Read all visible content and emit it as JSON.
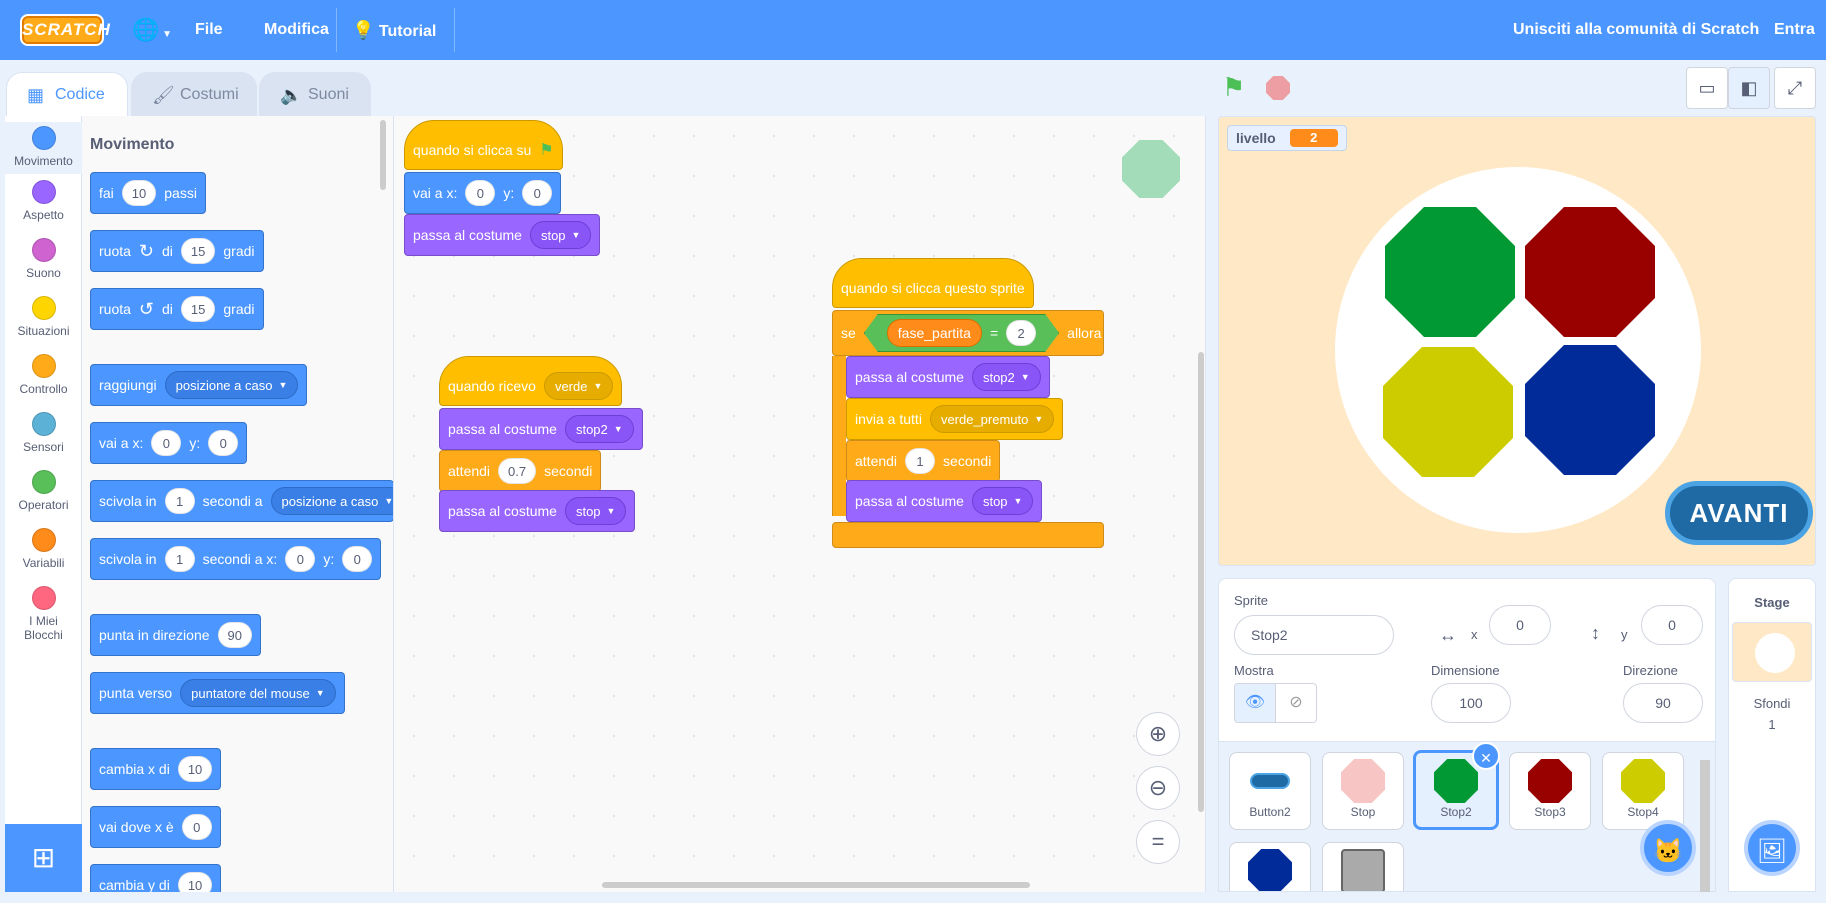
{
  "menu": {
    "logo": "SCRATCH",
    "file": "File",
    "edit": "Modifica",
    "tutorial": "Tutorial",
    "join": "Unisciti alla comunità di Scratch",
    "signin": "Entra"
  },
  "tabs": {
    "code": "Codice",
    "costumes": "Costumi",
    "sounds": "Suoni"
  },
  "categories": [
    {
      "label": "Movimento",
      "color": "#4c97ff"
    },
    {
      "label": "Aspetto",
      "color": "#9966ff"
    },
    {
      "label": "Suono",
      "color": "#cf63cf"
    },
    {
      "label": "Situazioni",
      "color": "#ffd500"
    },
    {
      "label": "Controllo",
      "color": "#ffab19"
    },
    {
      "label": "Sensori",
      "color": "#5cb1d6"
    },
    {
      "label": "Operatori",
      "color": "#59c059"
    },
    {
      "label": "Variabili",
      "color": "#ff8c1a"
    },
    {
      "label": "I Miei Blocchi",
      "color": "#ff6680"
    }
  ],
  "palette": {
    "title": "Movimento",
    "move": {
      "a": "fai",
      "val": "10",
      "b": "passi"
    },
    "turn_right": {
      "a": "ruota",
      "b": "di",
      "val": "15",
      "c": "gradi"
    },
    "turn_left": {
      "a": "ruota",
      "b": "di",
      "val": "15",
      "c": "gradi"
    },
    "goto": {
      "a": "raggiungi",
      "dd": "posizione a caso"
    },
    "gotoxy": {
      "a": "vai a x:",
      "x": "0",
      "b": "y:",
      "y": "0"
    },
    "glide": {
      "a": "scivola in",
      "val": "1",
      "b": "secondi a",
      "dd": "posizione a caso"
    },
    "glidexy": {
      "a": "scivola in",
      "val": "1",
      "b": "secondi a x:",
      "x": "0",
      "c": "y:",
      "y": "0"
    },
    "point_dir": {
      "a": "punta in direzione",
      "val": "90"
    },
    "point_to": {
      "a": "punta verso",
      "dd": "puntatore del mouse"
    },
    "change_x": {
      "a": "cambia x di",
      "val": "10"
    },
    "set_x": {
      "a": "vai dove x è",
      "val": "0"
    },
    "change_y": {
      "a": "cambia y di",
      "val": "10"
    }
  },
  "scripts": {
    "s1": {
      "hat": "quando si clicca su",
      "goto_a": "vai a x:",
      "goto_x": "0",
      "goto_b": "y:",
      "goto_y": "0",
      "costume_a": "passa al costume",
      "costume_dd": "stop"
    },
    "s2": {
      "hat": "quando ricevo",
      "hat_dd": "verde",
      "costume1_a": "passa al costume",
      "costume1_dd": "stop2",
      "wait_a": "attendi",
      "wait_val": "0.7",
      "wait_b": "secondi",
      "costume2_a": "passa al costume",
      "costume2_dd": "stop"
    },
    "s3": {
      "hat": "quando si clicca questo sprite",
      "if_a": "se",
      "var": "fase_partita",
      "eq": "=",
      "eq_val": "2",
      "if_b": "allora",
      "costume1_a": "passa al costume",
      "costume1_dd": "stop2",
      "bcast_a": "invia a tutti",
      "bcast_dd": "verde_premuto",
      "wait_a": "attendi",
      "wait_val": "1",
      "wait_b": "secondi",
      "costume2_a": "passa al costume",
      "costume2_dd": "stop"
    }
  },
  "stage": {
    "monitor_label": "livello",
    "monitor_value": "2",
    "avanti": "AVANTI",
    "octagon_colors": [
      "#009933",
      "#990000",
      "#cccc00",
      "#002b99"
    ]
  },
  "sprite_info": {
    "sprite_label": "Sprite",
    "sprite_name": "Stop2",
    "x_label": "x",
    "x": "0",
    "y_label": "y",
    "y": "0",
    "show_label": "Mostra",
    "size_label": "Dimensione",
    "size": "100",
    "dir_label": "Direzione",
    "dir": "90"
  },
  "sprites": [
    {
      "name": "Button2"
    },
    {
      "name": "Stop"
    },
    {
      "name": "Stop2"
    },
    {
      "name": "Stop3"
    },
    {
      "name": "Stop4"
    }
  ],
  "stage_panel": {
    "title": "Stage",
    "backdrops_label": "Sfondi",
    "backdrops_count": "1"
  }
}
